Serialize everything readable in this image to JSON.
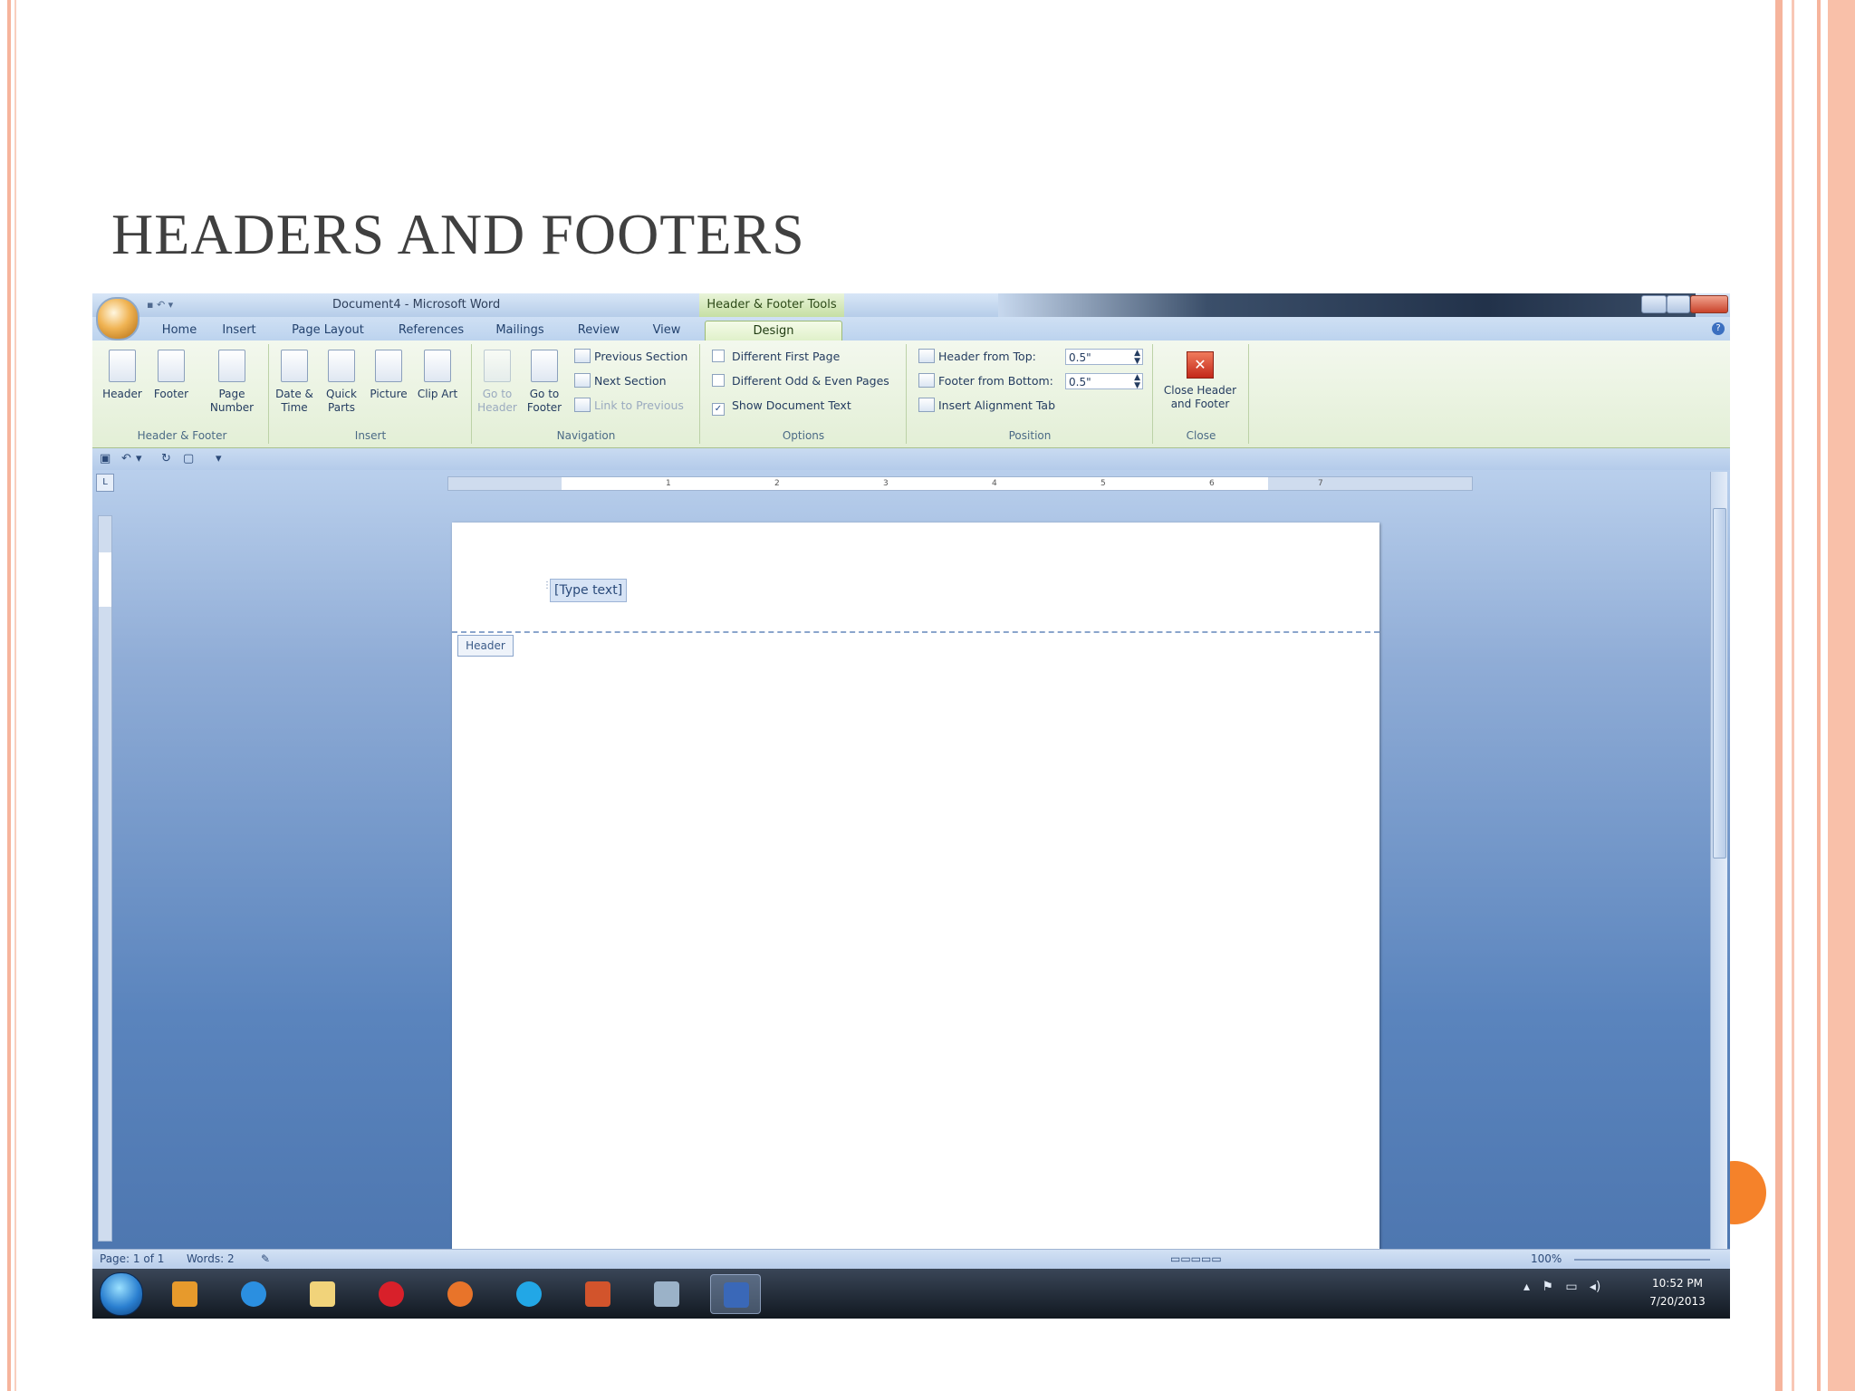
{
  "slide": {
    "title": "HEADERS AND FOOTERS",
    "accent_color": "#f6b49c",
    "dot_color": "#f5822a"
  },
  "window": {
    "document_title": "Document4 - Microsoft Word",
    "context_tab_group": "Header & Footer Tools"
  },
  "tabs": [
    "Home",
    "Insert",
    "Page Layout",
    "References",
    "Mailings",
    "Review",
    "View",
    "Design"
  ],
  "ribbon": {
    "groups": {
      "header_footer": "Header & Footer",
      "insert": "Insert",
      "navigation": "Navigation",
      "options": "Options",
      "position": "Position",
      "close": "Close"
    },
    "buttons": {
      "header": "Header",
      "footer": "Footer",
      "page_number": "Page Number",
      "date_time": "Date & Time",
      "quick_parts": "Quick Parts",
      "picture": "Picture",
      "clip_art": "Clip Art",
      "go_to_header": "Go to Header",
      "go_to_footer": "Go to Footer",
      "previous_section": "Previous Section",
      "next_section": "Next Section",
      "link_to_previous": "Link to Previous",
      "close_header_footer": "Close Header and Footer"
    },
    "options": {
      "different_first_page": "Different First Page",
      "different_odd_even": "Different Odd & Even Pages",
      "show_document_text": "Show Document Text",
      "show_document_text_checked": "✓"
    },
    "position": {
      "header_from_top_label": "Header from Top:",
      "header_from_top_value": "0.5\"",
      "footer_from_bottom_label": "Footer from Bottom:",
      "footer_from_bottom_value": "0.5\"",
      "insert_alignment_tab": "Insert Alignment Tab"
    }
  },
  "ruler": [
    "1",
    "2",
    "3",
    "4",
    "5",
    "6",
    "7"
  ],
  "document": {
    "placeholder": "[Type text]",
    "header_tag": "Header"
  },
  "statusbar": {
    "page": "Page: 1 of 1",
    "words": "Words: 2",
    "zoom": "100%"
  },
  "taskbar": {
    "time": "10:52 PM",
    "date": "7/20/2013",
    "app_icons": [
      "media-player-icon",
      "internet-explorer-icon",
      "file-explorer-icon",
      "opera-icon",
      "firefox-icon",
      "skype-icon",
      "powerpoint-icon",
      "paint-icon",
      "word-icon"
    ]
  }
}
